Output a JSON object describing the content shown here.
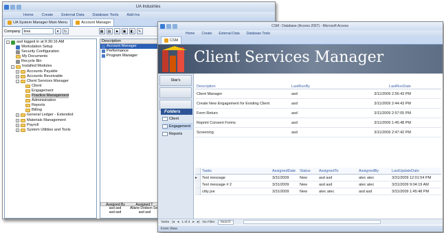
{
  "back": {
    "title": "UA Industries",
    "ribbon_tabs": [
      "Home",
      "Create",
      "External Data",
      "Database Tools",
      "Add-Ins"
    ],
    "doc_tabs": [
      {
        "label": "UA System Manager Main Menu"
      },
      {
        "label": "Account Manager"
      }
    ],
    "company_label": "Company",
    "company_value": "bres",
    "tree": [
      {
        "indent": 0,
        "exp": "-",
        "icon": "green",
        "text": "asd logged in at 9:30:16 AM"
      },
      {
        "indent": 1,
        "exp": "",
        "icon": "blue",
        "text": "Workstation Setup"
      },
      {
        "indent": 1,
        "exp": "",
        "icon": "grey",
        "text": "Security Configuration"
      },
      {
        "indent": 1,
        "exp": "",
        "icon": "folder",
        "text": "My Documents"
      },
      {
        "indent": 1,
        "exp": "",
        "icon": "grey",
        "text": "Recycle Bin"
      },
      {
        "indent": 1,
        "exp": "-",
        "icon": "folder",
        "text": "Installed Modules"
      },
      {
        "indent": 2,
        "exp": "+",
        "icon": "folder",
        "text": "Accounts Payable"
      },
      {
        "indent": 2,
        "exp": "+",
        "icon": "folder",
        "text": "Accounts Receivable"
      },
      {
        "indent": 2,
        "exp": "-",
        "icon": "folder",
        "text": "Client Services Manager"
      },
      {
        "indent": 3,
        "exp": "",
        "icon": "folder",
        "text": "Client"
      },
      {
        "indent": 3,
        "exp": "",
        "icon": "folder",
        "text": "Engagement"
      },
      {
        "indent": 3,
        "exp": "",
        "icon": "folder",
        "text": "Practice Management",
        "selected": true
      },
      {
        "indent": 3,
        "exp": "",
        "icon": "folder",
        "text": "Administration"
      },
      {
        "indent": 3,
        "exp": "",
        "icon": "folder",
        "text": "Reports"
      },
      {
        "indent": 3,
        "exp": "",
        "icon": "folder",
        "text": "Billing"
      },
      {
        "indent": 2,
        "exp": "+",
        "icon": "folder",
        "text": "General Ledger - Extended"
      },
      {
        "indent": 2,
        "exp": "+",
        "icon": "folder",
        "text": "Materials Management"
      },
      {
        "indent": 2,
        "exp": "+",
        "icon": "folder",
        "text": "Payroll"
      },
      {
        "indent": 2,
        "exp": "+",
        "icon": "folder",
        "text": "System Utilities and Tools"
      }
    ],
    "desc_header": "Description",
    "desc_items": [
      {
        "text": "Account Manager",
        "selected": true
      },
      {
        "text": "Performance",
        "selected": false
      },
      {
        "text": "Program Manager",
        "selected": false
      }
    ],
    "assigned": {
      "headers": [
        "Assigned By",
        "Assigned T"
      ],
      "rows": [
        [
          "asd asd",
          "Allane Dodson Sea"
        ],
        [
          "asd asd",
          "asd asd"
        ]
      ]
    }
  },
  "front": {
    "title": "CSM : Database (Access 2007) - Microsoft Access",
    "ribbon_tabs": [
      "Home",
      "Create",
      "External Data",
      "Database Tools"
    ],
    "doc_tab": "CSM",
    "banner_title": "Client Services Manager",
    "side_buttons": [
      "Sbar's",
      "",
      "",
      "",
      ""
    ],
    "folders_title": "Folders",
    "folders": [
      {
        "label": "Client",
        "selected": false
      },
      {
        "label": "Engagement",
        "selected": true
      },
      {
        "label": "Reports",
        "selected": false
      }
    ],
    "forms_grid": {
      "headers": [
        "Description",
        "LastRunBy",
        "LastRunDate"
      ],
      "rows": [
        [
          "Client Manager",
          "asd",
          "3/11/2009 2:56:43 PM"
        ],
        [
          "Create New Engagement for Existing Client",
          "asd",
          "3/11/2009 2:44:43 PM"
        ],
        [
          "Form Return",
          "asd",
          "3/11/2009 2:57:05 PM"
        ],
        [
          "Reprint Consent Forms",
          "asd",
          "3/11/2009 1:45:48 PM"
        ],
        [
          "Screening",
          "asd",
          "3/11/2009 2:47:42 PM"
        ]
      ]
    },
    "tasks_grid": {
      "headers": [
        "Tasks",
        "AssignedDate",
        "Status",
        "AssignedTo",
        "AssignedBy",
        "LastUpdateDate"
      ],
      "rows": [
        [
          "Text message",
          "3/31/2009",
          "New",
          "asd asd",
          "atec atec",
          "3/31/2009 12:01:54 PM"
        ],
        [
          "Text message # 2",
          "3/31/2009",
          "New",
          "asd asd",
          "atec atec",
          "3/31/2009 9:04:19 AM"
        ],
        [
          "citty joe",
          "3/31/2009",
          "New",
          "atec atec",
          "asd asd",
          "3/31/2009 1:45:48 PM"
        ]
      ]
    },
    "navbar": {
      "prefix": "Tasks",
      "record": "1 of 3",
      "filter": "No Filter",
      "search": "Search"
    },
    "status": "Form View"
  },
  "colors": {
    "banner": "#3d4d66",
    "folders_header": "#2f5596",
    "selection": "#2b5fb6"
  }
}
